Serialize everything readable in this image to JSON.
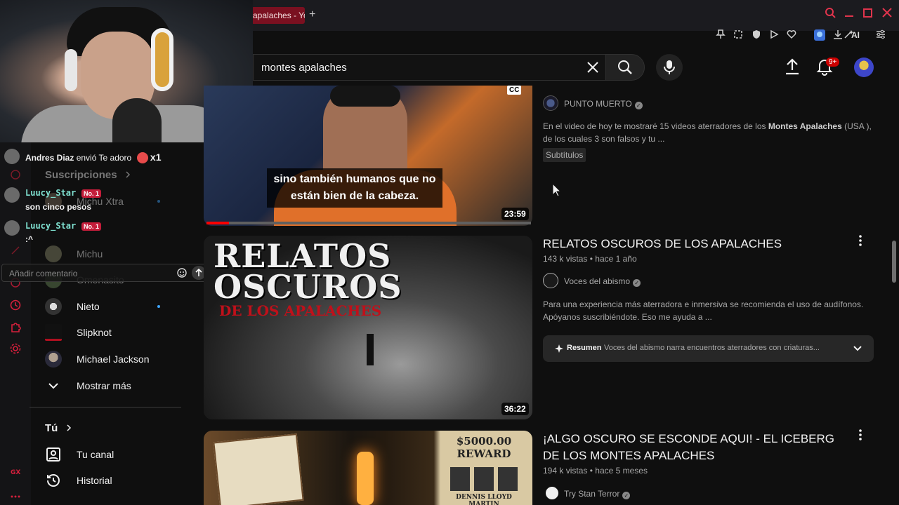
{
  "browser": {
    "tab_title": "apalaches - Yo",
    "new_tab": "+",
    "ai_label": "AI"
  },
  "header": {
    "search_value": "montes apalaches",
    "notif_badge": "9+"
  },
  "chat": {
    "messages": [
      {
        "name": "Andres Diaz",
        "text": "envió Te adoro",
        "count": "x1"
      },
      {
        "name": "Luucy_Star",
        "badge": "No. 1",
        "text": "son cinco pesos"
      },
      {
        "name": "Luucy_Star",
        "badge": "No. 1",
        "text": ":^"
      }
    ],
    "comment_placeholder": "Añadir comentario"
  },
  "sidebar": {
    "subscriptions_title": "Suscripciones",
    "subscriptions": [
      {
        "label": "Michu Xtra"
      },
      {
        "label": "Michu"
      },
      {
        "label": "Omenasito"
      },
      {
        "label": "Nieto"
      },
      {
        "label": "Slipknot"
      },
      {
        "label": "Michael Jackson"
      }
    ],
    "show_more": "Mostrar más",
    "you_title": "Tú",
    "you_items": [
      {
        "label": "Tu canal"
      },
      {
        "label": "Historial"
      }
    ]
  },
  "results": [
    {
      "channel": "PUNTO MUERTO",
      "description_plain_1": "En el video de hoy te mostraré 15 videos aterradores de los ",
      "description_bold": "Montes Apalaches",
      "description_plain_2": " (USA ), de los cuales 3 son falsos y tu ...",
      "chip": "Subtítulos",
      "caption": "sino también humanos que no están bien de la cabeza.",
      "cc": "CC",
      "duration": "23:59",
      "progress": 0.07
    },
    {
      "title": "RELATOS OSCUROS DE LOS APALACHES",
      "views": "143 k vistas",
      "age": "hace 1 año",
      "meta_sep": "•",
      "channel": "Voces del abismo",
      "description": "Para una experiencia más aterradora e inmersiva se recomienda el uso de audífonos. Apóyanos suscribiéndote. Eso me ayuda a ...",
      "summary_label": "Resumen",
      "summary_text": "Voces del abismo narra encuentros aterradores con criaturas...",
      "duration": "36:22",
      "thumb_text_1": "RELATOS",
      "thumb_text_2": "OSCUROS",
      "thumb_text_3": "DE LOS APALACHES"
    },
    {
      "title": "¡ALGO OSCURO SE ESCONDE AQUI! - EL ICEBERG DE LOS MONTES APALACHES",
      "views": "194 k vistas",
      "age": "hace 5 meses",
      "meta_sep": "•",
      "channel": "Try Stan Terror",
      "poster_title": "$5000.00 REWARD",
      "poster_names": "DENNIS LLOYD MARTIN"
    }
  ],
  "colors": {
    "accent": "#ff0000",
    "opera_red": "#e0344c",
    "bg": "#0f0f0f"
  }
}
